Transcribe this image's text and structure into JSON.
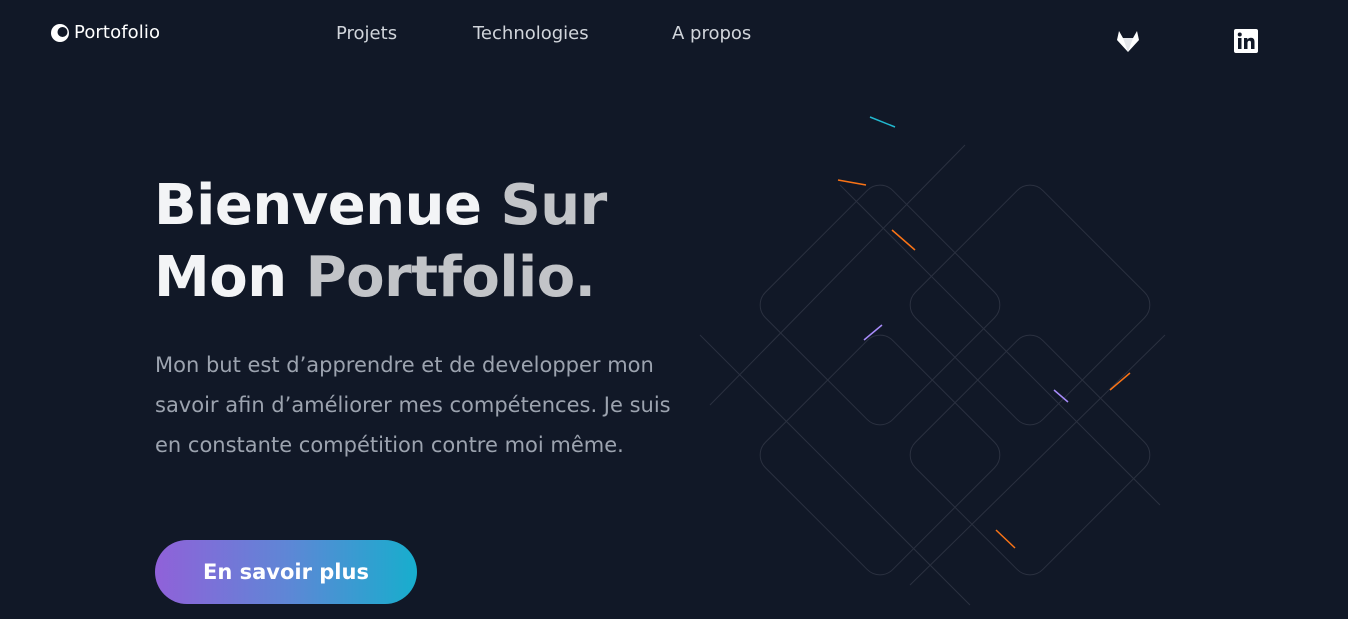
{
  "header": {
    "logo_text": "Portofolio",
    "nav": {
      "projets": "Projets",
      "technologies": "Technologies",
      "apropos": "A propos"
    },
    "social": [
      {
        "icon": "gitlab-icon"
      },
      {
        "icon": "linkedin-icon"
      }
    ]
  },
  "hero": {
    "title_line1_a": "Bienvenue",
    "title_line1_b": "Sur",
    "title_line2_a": "Mon",
    "title_line2_b": "Portfolio.",
    "description": "Mon but est d’apprendre et de developper mon savoir afin d’améliorer mes compétences. Je suis en constante compétition contre moi même.",
    "cta_label": "En savoir plus"
  },
  "colors": {
    "background": "#111827",
    "cta_gradient_start": "#9061d9",
    "cta_gradient_end": "#17aecd",
    "title_primary": "#f3f4f6",
    "title_secondary": "#c2c4c8",
    "description": "#9ca3af"
  }
}
